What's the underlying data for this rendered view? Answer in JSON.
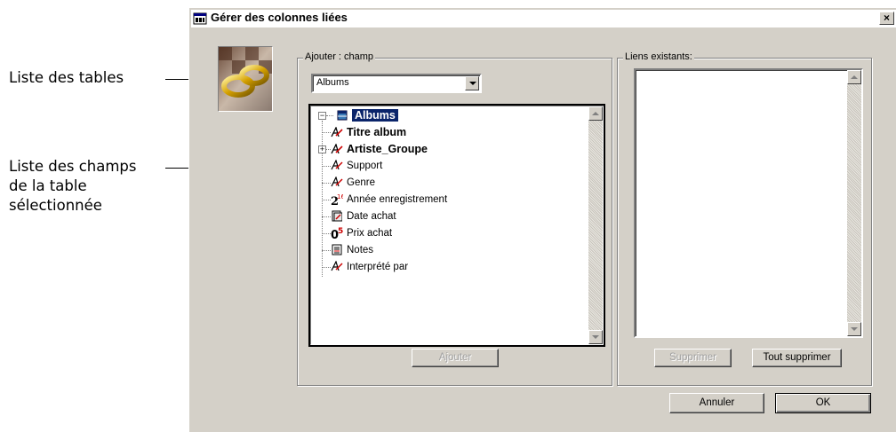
{
  "callouts": {
    "tables_list": "Liste des tables",
    "fields_list": "Liste des champs\nde la table\nsélectionnée"
  },
  "dialog": {
    "title": "Gérer des colonnes liées",
    "close_glyph": "×",
    "add_group": {
      "legend": "Ajouter : champ",
      "table_select_value": "Albums",
      "tree_root": "Albums",
      "fields": [
        {
          "label": "Titre album",
          "icon": "text-field-icon",
          "bold": true
        },
        {
          "label": "Artiste_Groupe",
          "icon": "text-field-icon",
          "bold": true,
          "expandable": true
        },
        {
          "label": "Support",
          "icon": "text-field-icon"
        },
        {
          "label": "Genre",
          "icon": "text-field-icon"
        },
        {
          "label": "Année enregistrement",
          "icon": "integer-field-icon"
        },
        {
          "label": "Date achat",
          "icon": "date-field-icon"
        },
        {
          "label": "Prix achat",
          "icon": "real-field-icon"
        },
        {
          "label": "Notes",
          "icon": "memo-field-icon"
        },
        {
          "label": "Interprété par",
          "icon": "text-field-icon"
        }
      ],
      "add_button": "Ajouter"
    },
    "links_group": {
      "legend": "Liens existants:",
      "delete_button": "Supprimer",
      "delete_all_button": "Tout supprimer"
    },
    "cancel_button": "Annuler",
    "ok_button": "OK"
  },
  "colors": {
    "dialog_bg": "#d4d0c8",
    "selection": "#0a246a",
    "field_icon_red": "#cc0000"
  }
}
